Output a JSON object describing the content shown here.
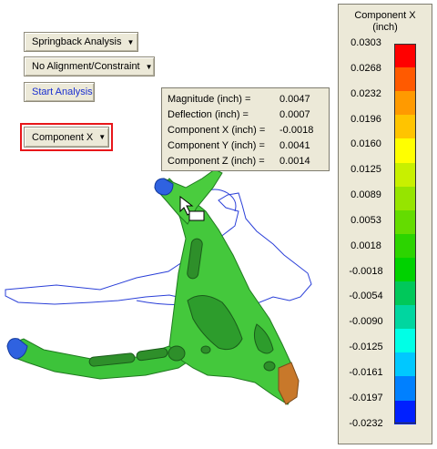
{
  "toolbar": {
    "springback_label": "Springback Analysis",
    "alignment_label": "No Alignment/Constraint",
    "start_label": "Start Analysis",
    "component_label": "Component X"
  },
  "readout": {
    "rows": [
      {
        "label": "Magnitude (inch) =",
        "value": "0.0047"
      },
      {
        "label": "Deflection (inch) =",
        "value": "0.0007"
      },
      {
        "label": "Component X (inch) =",
        "value": "-0.0018"
      },
      {
        "label": "Component Y (inch) =",
        "value": "0.0041"
      },
      {
        "label": "Component Z (inch) =",
        "value": "0.0014"
      }
    ]
  },
  "legend": {
    "title_line1": "Component X",
    "title_line2": "(inch)",
    "ticks": [
      "0.0303",
      "0.0268",
      "0.0232",
      "0.0196",
      "0.0160",
      "0.0125",
      "0.0089",
      "0.0053",
      "0.0018",
      "-0.0018",
      "-0.0054",
      "-0.0090",
      "-0.0125",
      "-0.0161",
      "-0.0197",
      "-0.0232"
    ],
    "colors": [
      "#ff0000",
      "#ff5a00",
      "#ff9a00",
      "#ffc400",
      "#ffff00",
      "#c8f000",
      "#96e400",
      "#64dc00",
      "#2cd400",
      "#00d200",
      "#00c85a",
      "#00d6a0",
      "#00ffe6",
      "#00c8ff",
      "#0080ff",
      "#0020ff"
    ]
  },
  "icons": {
    "arrow": "chevron-down-icon",
    "cursor": "hand-cursor-icon"
  }
}
